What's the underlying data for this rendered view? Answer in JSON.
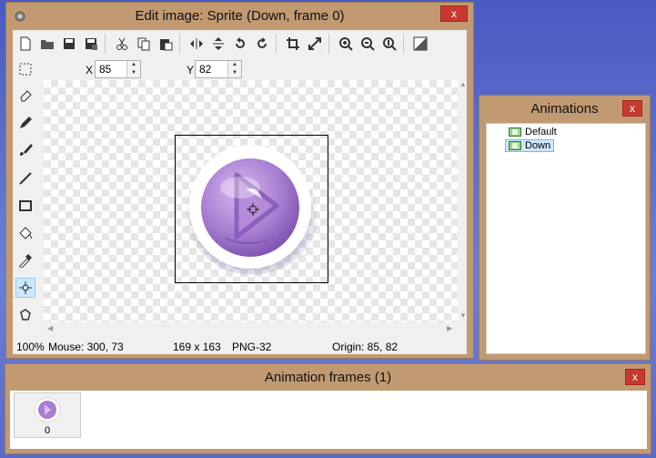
{
  "editor": {
    "title": "Edit image: Sprite (Down, frame 0)",
    "close_label": "x",
    "toolbar_icons": [
      "new-icon",
      "open-icon",
      "save-icon",
      "save-as-icon",
      "cut-icon",
      "copy-icon",
      "paste-icon",
      "flip-horizontal-icon",
      "flip-vertical-icon",
      "rotate-left-icon",
      "rotate-right-icon",
      "crop-icon",
      "resize-icon",
      "zoom-in-icon",
      "zoom-out-icon",
      "zoom-actual-icon",
      "transparency-icon"
    ],
    "x_label": "X",
    "x_value": "85",
    "y_label": "Y",
    "y_value": "82",
    "tools": [
      "select-tool-icon",
      "eraser-tool-icon",
      "pencil-tool-icon",
      "brush-tool-icon",
      "line-tool-icon",
      "rectangle-tool-icon",
      "fill-tool-icon",
      "eyedropper-tool-icon",
      "origin-tool-icon",
      "polygon-tool-icon"
    ],
    "status": {
      "zoom": "100%",
      "mouse": "Mouse: 300, 73",
      "size": "169 x 163",
      "format": "PNG-32",
      "origin": "Origin: 85, 82"
    }
  },
  "animations": {
    "title": "Animations",
    "close_label": "x",
    "items": [
      {
        "label": "Default",
        "selected": false
      },
      {
        "label": "Down",
        "selected": true
      }
    ]
  },
  "frames": {
    "title": "Animation frames (1)",
    "close_label": "x",
    "items": [
      {
        "label": "0"
      }
    ]
  },
  "colors": {
    "window_chrome": "#c19a72",
    "close_button": "#c7392f",
    "selection": "#cce8ff",
    "sprite_purple": "#9a6bc8"
  }
}
